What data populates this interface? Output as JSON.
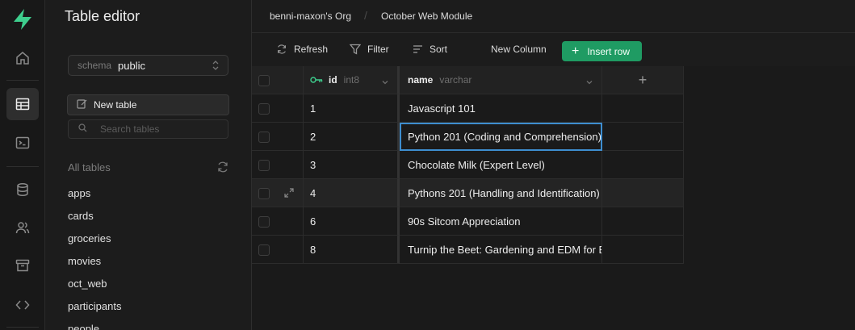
{
  "rail": {
    "items": [
      "home-icon",
      "table-editor-icon",
      "sql-editor-icon",
      "database-icon",
      "auth-users-icon",
      "storage-icon",
      "api-icon"
    ]
  },
  "sidebar": {
    "title": "Table editor",
    "schema_label": "schema",
    "schema_value": "public",
    "new_table_label": "New table",
    "search_placeholder": "Search tables",
    "all_tables_label": "All tables",
    "tables": [
      "apps",
      "cards",
      "groceries",
      "movies",
      "oct_web",
      "participants",
      "people"
    ]
  },
  "topbar": {
    "org": "benni-maxon's Org",
    "separator": "/",
    "project": "October Web Module"
  },
  "toolbar": {
    "refresh_label": "Refresh",
    "filter_label": "Filter",
    "sort_label": "Sort",
    "new_column_label": "New Column",
    "insert_row_label": "Insert row"
  },
  "grid": {
    "columns": [
      {
        "name": "id",
        "type": "int8",
        "primary_key": true
      },
      {
        "name": "name",
        "type": "varchar"
      }
    ],
    "add_column_symbol": "+",
    "rows": [
      {
        "id": "1",
        "name": "Javascript 101"
      },
      {
        "id": "2",
        "name": "Python 201 (Coding and Comprehension)"
      },
      {
        "id": "3",
        "name": "Chocolate Milk (Expert Level)"
      },
      {
        "id": "4",
        "name": "Pythons 201 (Handling and Identification)"
      },
      {
        "id": "6",
        "name": "90s Sitcom Appreciation"
      },
      {
        "id": "8",
        "name": "Turnip the Beet: Gardening and EDM for Beginners"
      }
    ]
  },
  "colors": {
    "brand": "#3ecf8e",
    "insert_button": "#1f9b63",
    "selection": "#3e8ed0",
    "background": "#1c1c1c"
  }
}
